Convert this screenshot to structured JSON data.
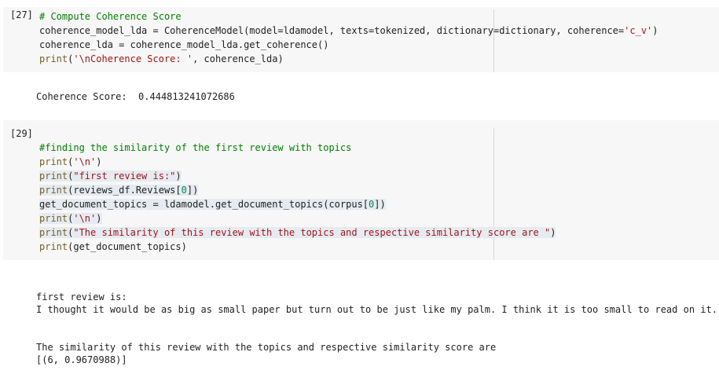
{
  "cells": [
    {
      "prompt": "[27]",
      "lines": [
        [
          {
            "t": "# Compute Coherence Score",
            "c": "c-com"
          }
        ],
        [
          {
            "t": "coherence_model_lda = CoherenceModel(model=ldamodel, texts=tokenized, dictionary=dictionary, coherence=",
            "c": ""
          },
          {
            "t": "'c_v'",
            "c": "c-str"
          },
          {
            "t": ")",
            "c": ""
          }
        ],
        [
          {
            "t": "coherence_lda = coherence_model_lda.get_coherence()",
            "c": ""
          }
        ],
        [
          {
            "t": "print",
            "c": "c-kw"
          },
          {
            "t": "(",
            "c": ""
          },
          {
            "t": "'\\nCoherence Score: '",
            "c": "c-str"
          },
          {
            "t": ", coherence_lda)",
            "c": ""
          }
        ]
      ],
      "output": [
        "Coherence Score:  0.444813241072686"
      ]
    },
    {
      "prompt": "[29]",
      "lines": [
        [
          {
            "t": "#finding the similarity of the first review with topics",
            "c": "c-com"
          }
        ],
        [
          {
            "t": "print",
            "c": "c-kw"
          },
          {
            "t": "(",
            "c": ""
          },
          {
            "t": "'\\n'",
            "c": "c-str"
          },
          {
            "t": ")",
            "c": ""
          }
        ],
        [
          {
            "t": "print",
            "c": "c-kw"
          },
          {
            "t": "(",
            "c": ""
          },
          {
            "t": "\"first review is:\"",
            "c": "c-str"
          },
          {
            "t": ")",
            "c": "hl"
          }
        ],
        [
          {
            "t": "print",
            "c": "c-kw"
          },
          {
            "t": "(reviews_df.Reviews[",
            "c": ""
          },
          {
            "t": "0",
            "c": "c-num"
          },
          {
            "t": "])",
            "c": ""
          }
        ],
        [
          {
            "t": "get_document_topics = ldamodel.get_document_topics(corpus[",
            "c": ""
          },
          {
            "t": "0",
            "c": "c-num"
          },
          {
            "t": "])",
            "c": ""
          }
        ],
        [
          {
            "t": "print",
            "c": "c-kw"
          },
          {
            "t": "(",
            "c": ""
          },
          {
            "t": "'\\n'",
            "c": "c-str"
          },
          {
            "t": ")",
            "c": ""
          }
        ],
        [
          {
            "t": "print",
            "c": "c-kw"
          },
          {
            "t": "(",
            "c": ""
          },
          {
            "t": "\"The similarity of this review with the topics and respective similarity score are \"",
            "c": "c-str"
          },
          {
            "t": ")",
            "c": ""
          }
        ],
        [
          {
            "t": "print",
            "c": "c-kw"
          },
          {
            "t": "(get_document_topics)",
            "c": ""
          }
        ]
      ],
      "output": [
        "first review is:",
        "I thought it would be as big as small paper but turn out to be just like my palm. I think it is too small to read on it...",
        "",
        "",
        "The similarity of this review with the topics and respective similarity score are",
        "[(6, 0.9670988)]"
      ]
    }
  ]
}
